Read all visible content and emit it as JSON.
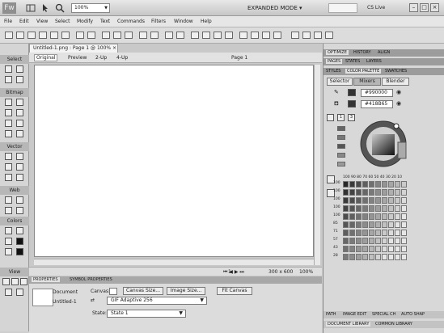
{
  "titlebar": {
    "logo": "Fw",
    "zoom": "100%",
    "mode": "EXPANDED MODE",
    "cs_live": "CS Live"
  },
  "menu": [
    "File",
    "Edit",
    "View",
    "Select",
    "Modify",
    "Text",
    "Commands",
    "Filters",
    "Window",
    "Help"
  ],
  "tools": {
    "sections": [
      "Select",
      "Bitmap",
      "Vector",
      "Web",
      "Colors",
      "View"
    ]
  },
  "document": {
    "tab": "Untitled-1.png : Page 1 @ 100%",
    "views": [
      "Original",
      "Preview",
      "2-Up",
      "4-Up"
    ],
    "page": "Page 1",
    "status": {
      "page_num": "1",
      "size": "300 x 600",
      "zoom": "100%"
    }
  },
  "properties": {
    "tabs": [
      "PROPERTIES",
      "SYMBOL PROPERTIES"
    ],
    "doc_type": "Document",
    "doc_name": "Untitled-1",
    "canvas_label": "Canvas:",
    "canvas_size_btn": "Canvas Size...",
    "image_size_btn": "Image Size...",
    "fit_canvas_btn": "Fit Canvas",
    "format": "GIF Adaptive 256",
    "state_label": "State:",
    "state": "State 1"
  },
  "panels": {
    "top_tabs": [
      "OPTIMIZE",
      "HISTORY",
      "ALIGN"
    ],
    "second_tabs": [
      "PAGES",
      "STATES",
      "LAYERS"
    ],
    "third_tabs": [
      "STYLES",
      "COLOR PALETTE",
      "SWATCHES"
    ],
    "palette_tabs": [
      "Selector",
      "Mixers",
      "Blender"
    ],
    "color1": "#990000",
    "color2": "#418B65",
    "palette_header": "100 90 80 70 60 50 40 30 20 10",
    "row_labels": [
      "100",
      "100",
      "100",
      "100",
      "100",
      "85",
      "71",
      "57",
      "43",
      "28"
    ],
    "bottom_tabs": [
      "PATH",
      "IMAGE EDIT",
      "SPECIAL CH",
      "AUTO SHAP"
    ],
    "library_tabs": [
      "DOCUMENT LIBRARY",
      "COMMON LIBRARY"
    ]
  }
}
